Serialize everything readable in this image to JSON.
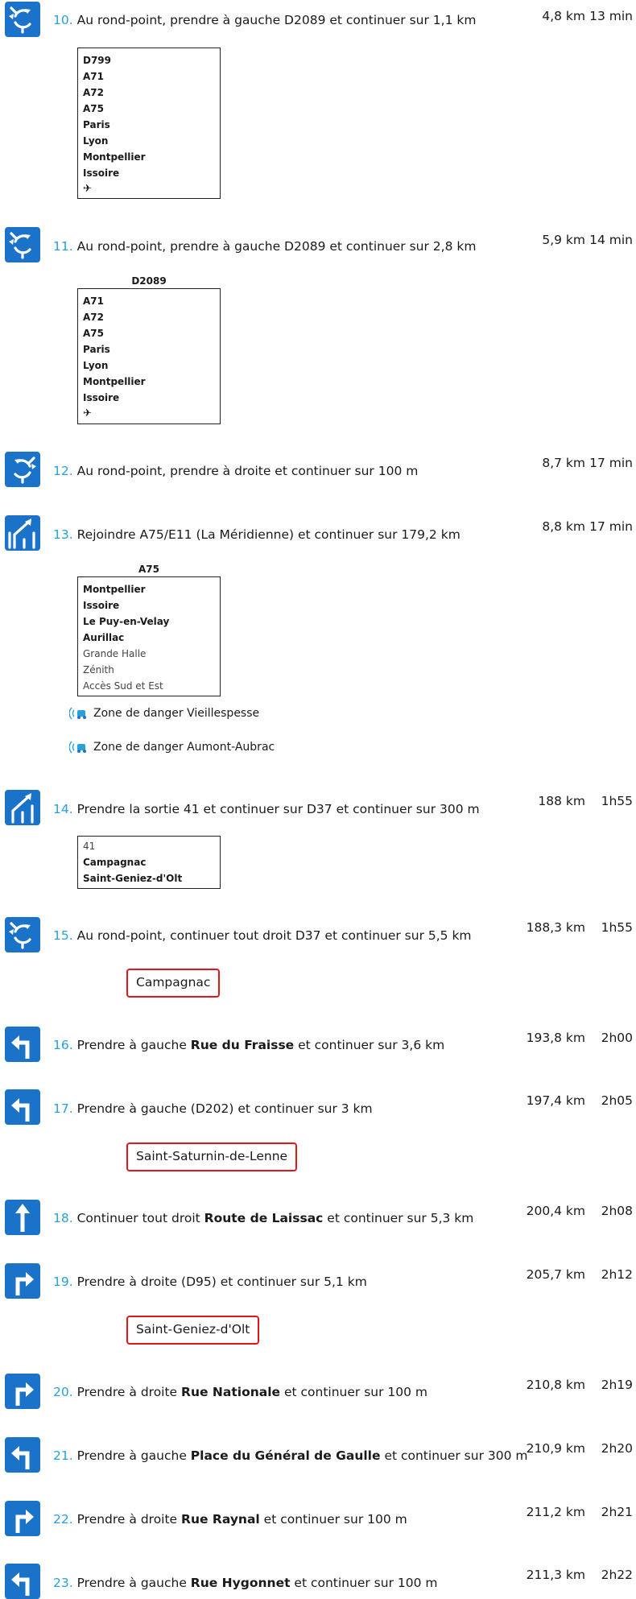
{
  "steps": [
    {
      "num": "10.",
      "text": "Au rond-point, prendre à gauche D2089 et continuer sur 1,1 km",
      "dist": "4,8 km",
      "time": "13 min",
      "icon": "roundabout-icon",
      "panel": {
        "items": [
          {
            "t": "D799",
            "s": "b"
          },
          {
            "t": "A71",
            "s": "b"
          },
          {
            "t": "A72",
            "s": "b"
          },
          {
            "t": "A75",
            "s": "b"
          },
          {
            "t": "Paris",
            "s": "b"
          },
          {
            "t": "Lyon",
            "s": "b"
          },
          {
            "t": "Montpellier",
            "s": "b"
          },
          {
            "t": "Issoire",
            "s": "b"
          }
        ],
        "plane": "✈"
      }
    },
    {
      "num": "11.",
      "text": "Au rond-point, prendre à gauche D2089 et continuer sur 2,8 km",
      "dist": "5,9 km",
      "time": "14 min",
      "icon": "roundabout-icon",
      "panel": {
        "head": "D2089",
        "items": [
          {
            "t": "A71",
            "s": "b"
          },
          {
            "t": "A72",
            "s": "b"
          },
          {
            "t": "A75",
            "s": "b"
          },
          {
            "t": "Paris",
            "s": "b"
          },
          {
            "t": "Lyon",
            "s": "b"
          },
          {
            "t": "Montpellier",
            "s": "b"
          },
          {
            "t": "Issoire",
            "s": "b"
          }
        ],
        "plane": "✈"
      }
    },
    {
      "num": "12.",
      "text": "Au rond-point, prendre à droite et continuer sur 100 m",
      "dist": "8,7 km",
      "time": "17 min",
      "icon": "roundabout-icon"
    },
    {
      "num": "13.",
      "text": "Rejoindre A75/E11 (La Méridienne) et continuer sur 179,2 km",
      "dist": "8,8 km",
      "time": "17 min",
      "icon": "merge-icon",
      "panel": {
        "head": "A75",
        "items": [
          {
            "t": "Montpellier",
            "s": "b"
          },
          {
            "t": "Issoire",
            "s": "b"
          },
          {
            "t": "Le Puy-en-Velay",
            "s": "b"
          },
          {
            "t": "Aurillac",
            "s": "b"
          },
          {
            "t": "Grande Halle",
            "s": "n"
          },
          {
            "t": "Zénith",
            "s": "n"
          },
          {
            "t": "Accès Sud et Est",
            "s": "n"
          }
        ]
      },
      "dangers": [
        "Zone de danger Vieillespesse",
        "Zone de danger Aumont-Aubrac"
      ]
    },
    {
      "num": "14.",
      "text": "Prendre la sortie 41 et continuer sur D37 et continuer sur 300 m",
      "dist": "188 km",
      "time": "1h55",
      "icon": "exit-icon",
      "panel": {
        "items": [
          {
            "t": "41",
            "s": "n"
          },
          {
            "t": "Campagnac",
            "s": "b"
          },
          {
            "t": "Saint-Geniez-d'Olt",
            "s": "b"
          }
        ]
      }
    },
    {
      "num": "15.",
      "text": "Au rond-point, continuer tout droit D37 et continuer sur 5,5 km",
      "dist": "188,3 km",
      "time": "1h55",
      "icon": "roundabout-icon",
      "sign": "Campagnac"
    },
    {
      "num": "16.",
      "text_pre": "Prendre à gauche ",
      "road": "Rue du Fraisse",
      "text_post": " et continuer sur 3,6 km",
      "dist": "193,8 km",
      "time": "2h00",
      "icon": "turn-left-icon"
    },
    {
      "num": "17.",
      "text": "Prendre à gauche (D202) et continuer sur 3 km",
      "dist": "197,4 km",
      "time": "2h05",
      "icon": "turn-left-icon",
      "sign": "Saint-Saturnin-de-Lenne"
    },
    {
      "num": "18.",
      "text_pre": "Continuer tout droit ",
      "road": "Route de Laissac",
      "text_post": " et continuer sur 5,3 km",
      "dist": "200,4 km",
      "time": "2h08",
      "icon": "straight-icon"
    },
    {
      "num": "19.",
      "text": "Prendre à droite (D95) et continuer sur 5,1 km",
      "dist": "205,7 km",
      "time": "2h12",
      "icon": "turn-right-icon",
      "sign": "Saint-Geniez-d'Olt"
    },
    {
      "num": "20.",
      "text_pre": "Prendre à droite ",
      "road": "Rue Nationale",
      "text_post": " et continuer sur 100 m",
      "dist": "210,8 km",
      "time": "2h19",
      "icon": "turn-right-icon"
    },
    {
      "num": "21.",
      "text_pre": "Prendre à gauche ",
      "road": "Place du Général de Gaulle",
      "text_post": " et continuer sur 300 m",
      "dist": "210,9 km",
      "time": "2h20",
      "icon": "turn-left-icon"
    },
    {
      "num": "22.",
      "text_pre": "Prendre à droite ",
      "road": "Rue Raynal",
      "text_post": " et continuer sur 100 m",
      "dist": "211,2 km",
      "time": "2h21",
      "icon": "turn-right-icon"
    },
    {
      "num": "23.",
      "text_pre": "Prendre à gauche ",
      "road": "Rue Hygonnet",
      "text_post": " et continuer sur 100 m",
      "dist": "211,3 km",
      "time": "2h22",
      "icon": "turn-left-icon"
    }
  ],
  "colors": {
    "icon_bg": "#1a73c9",
    "step_number": "#2aa0d8",
    "sign_border": "#e3161b"
  }
}
